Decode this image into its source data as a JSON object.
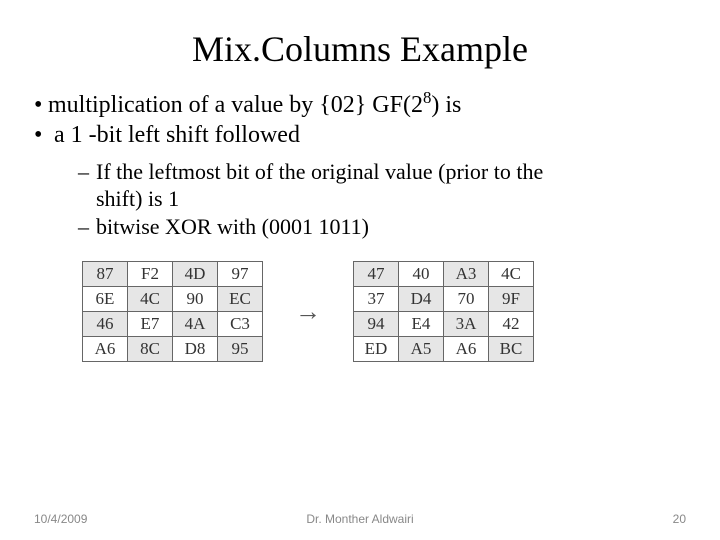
{
  "title": "Mix.Columns Example",
  "bullets": {
    "b1_pre": "multiplication of a value by {02} GF(2",
    "b1_sup": "8",
    "b1_post": ") is",
    "b2": " a 1 -bit left shift followed"
  },
  "sub_bullets": {
    "s1_line1": "If the leftmost bit of the original value (prior to the",
    "s1_line2": "shift) is 1",
    "s2": "bitwise XOR with (0001 1011)"
  },
  "arrow": "→",
  "matrix_left": [
    [
      "87",
      "F2",
      "4D",
      "97"
    ],
    [
      "6E",
      "4C",
      "90",
      "EC"
    ],
    [
      "46",
      "E7",
      "4A",
      "C3"
    ],
    [
      "A6",
      "8C",
      "D8",
      "95"
    ]
  ],
  "matrix_right": [
    [
      "47",
      "40",
      "A3",
      "4C"
    ],
    [
      "37",
      "D4",
      "70",
      "9F"
    ],
    [
      "94",
      "E4",
      "3A",
      "42"
    ],
    [
      "ED",
      "A5",
      "A6",
      "BC"
    ]
  ],
  "footer": {
    "date": "10/4/2009",
    "author": "Dr. Monther Aldwairi",
    "page": "20"
  },
  "chart_data": {
    "type": "table",
    "tables": [
      {
        "name": "input_state",
        "rows": [
          [
            "87",
            "F2",
            "4D",
            "97"
          ],
          [
            "6E",
            "4C",
            "90",
            "EC"
          ],
          [
            "46",
            "E7",
            "4A",
            "C3"
          ],
          [
            "A6",
            "8C",
            "D8",
            "95"
          ]
        ]
      },
      {
        "name": "output_state",
        "rows": [
          [
            "47",
            "40",
            "A3",
            "4C"
          ],
          [
            "37",
            "D4",
            "70",
            "9F"
          ],
          [
            "94",
            "E4",
            "3A",
            "42"
          ],
          [
            "ED",
            "A5",
            "A6",
            "BC"
          ]
        ]
      }
    ]
  }
}
